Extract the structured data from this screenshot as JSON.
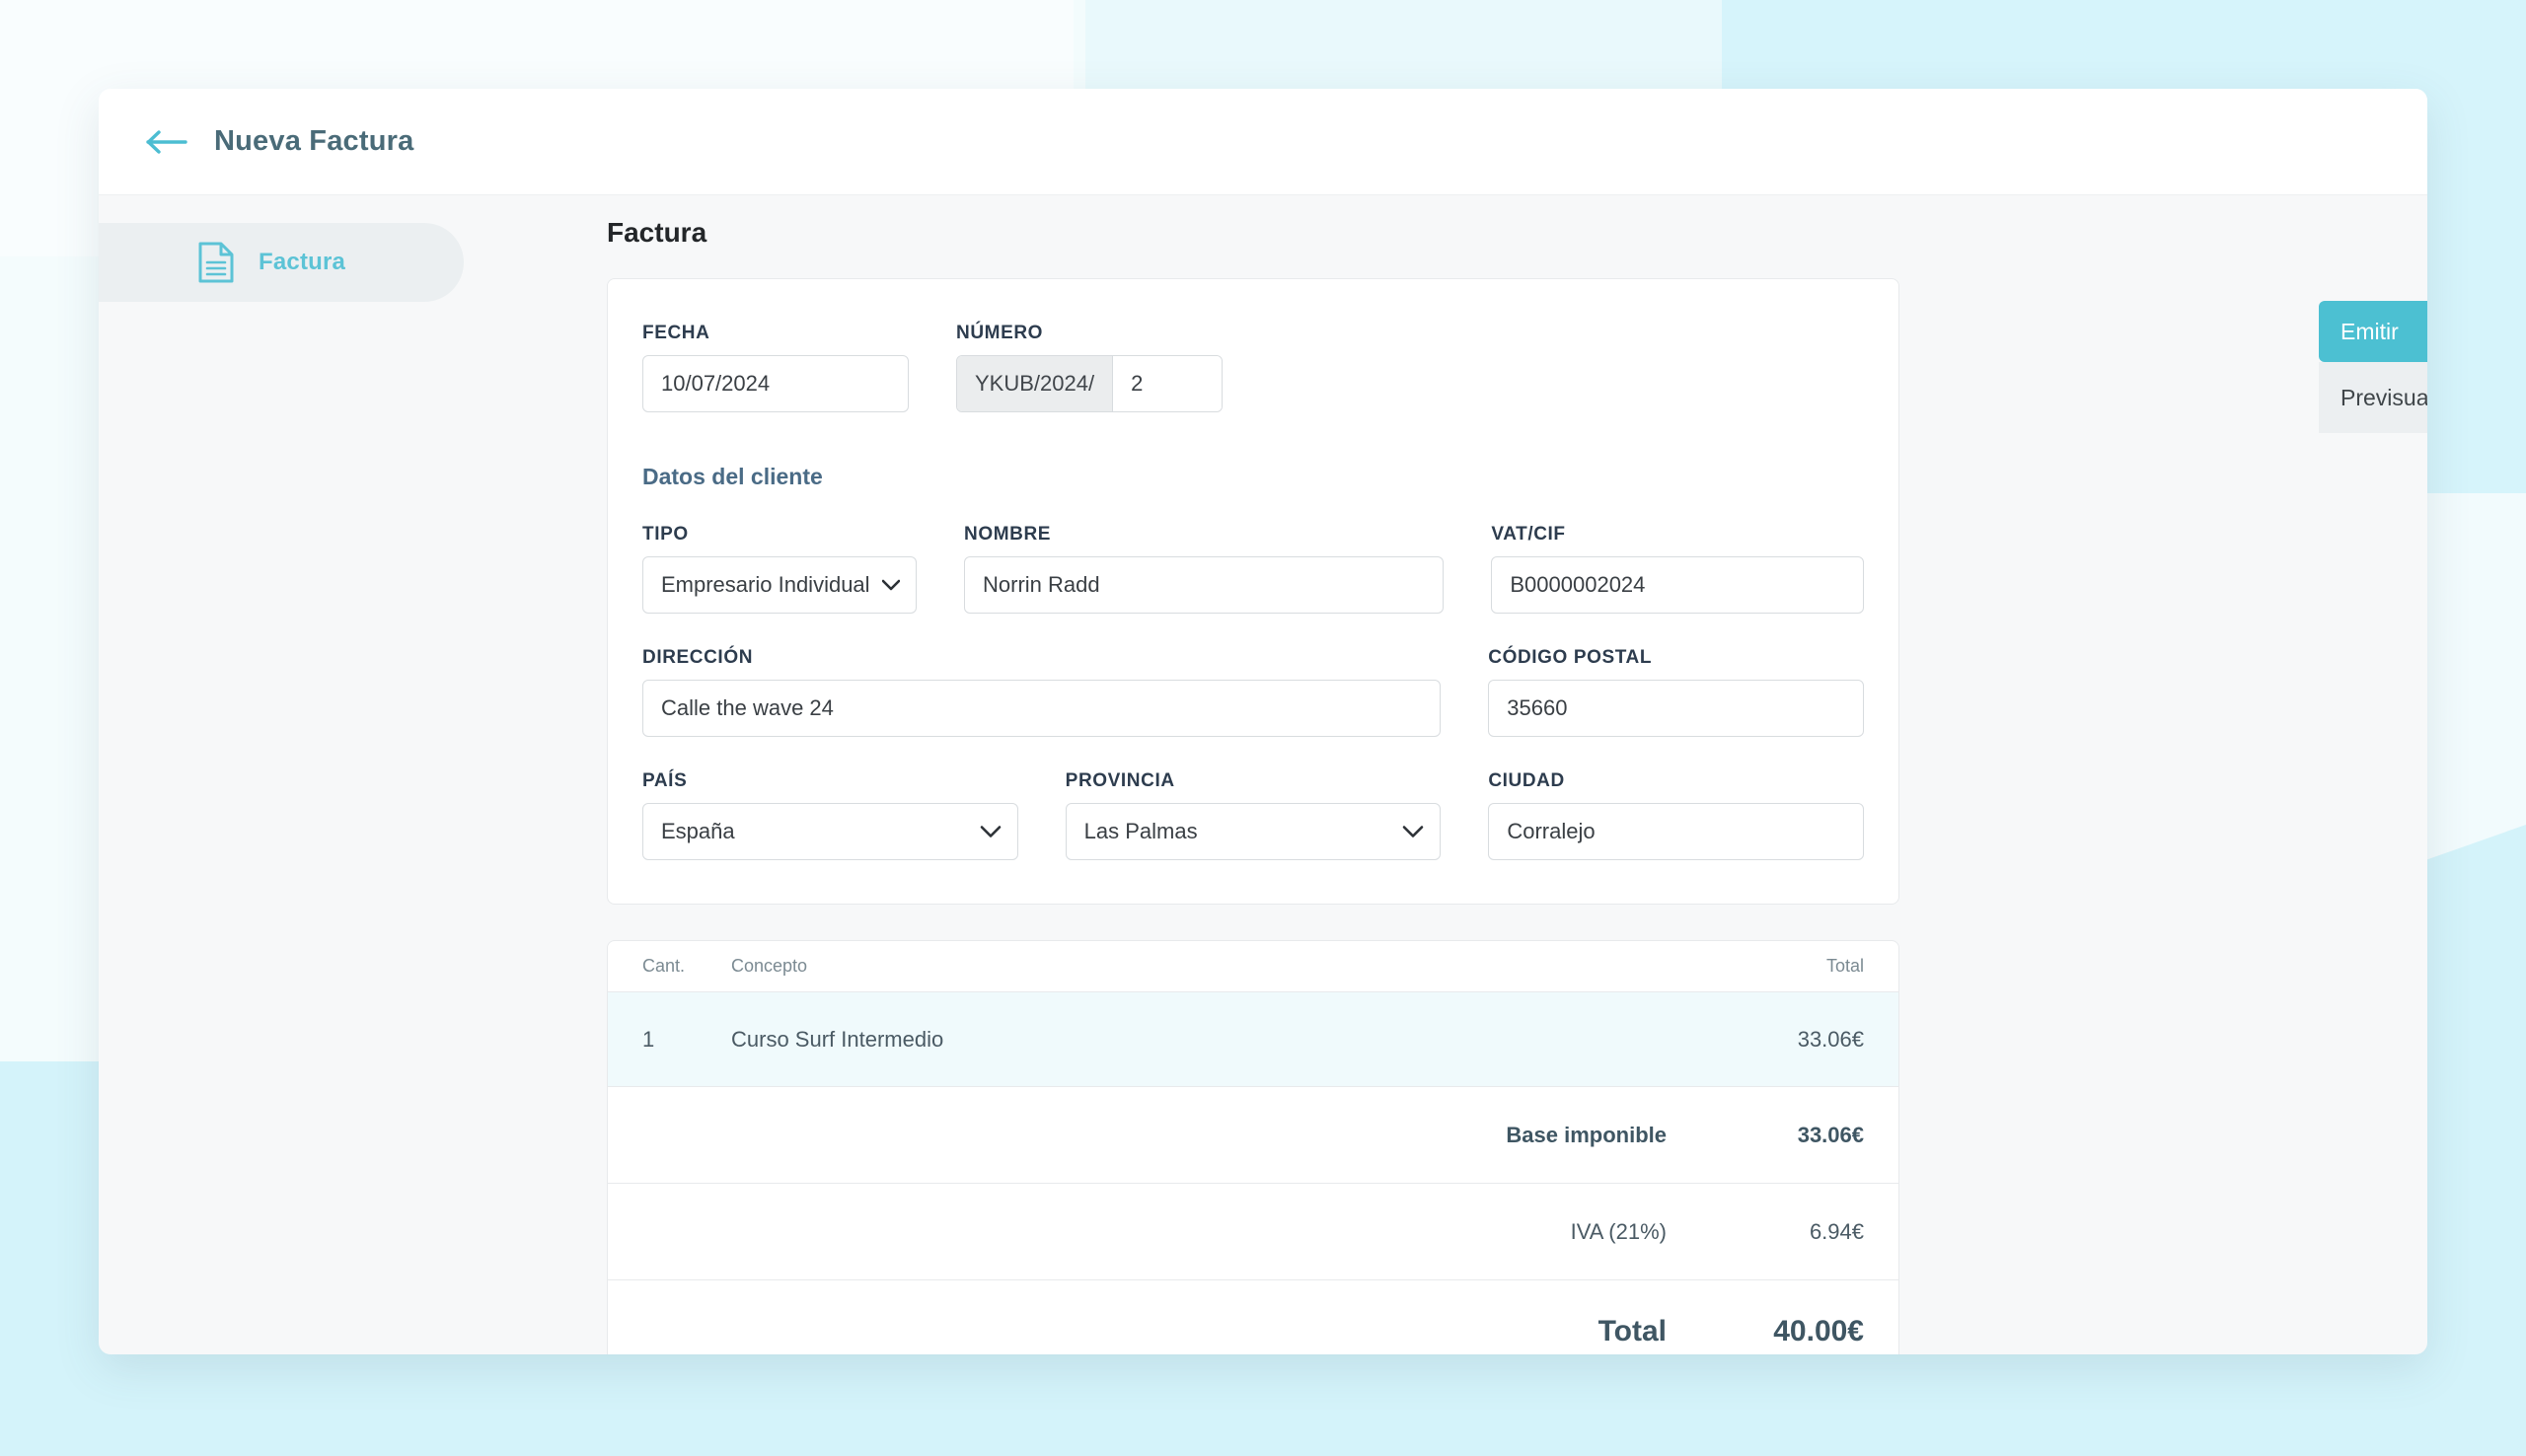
{
  "theme": {
    "accent": "#4cc0d2",
    "accent_text": "#5cc3d6",
    "title_color": "#4a6b78",
    "label_color": "#2d3c4e",
    "subheading_color": "#4a6b86",
    "page_bg": "#f7f8f9",
    "row_highlight": "#f0fafc"
  },
  "header": {
    "back_icon": "arrow-left-icon",
    "title": "Nueva Factura"
  },
  "sidebar": {
    "items": [
      {
        "label": "Factura",
        "icon": "document-text-icon",
        "active": true
      }
    ]
  },
  "main": {
    "section_title": "Factura",
    "invoice": {
      "fecha": {
        "label": "FECHA",
        "value": "10/07/2024"
      },
      "numero": {
        "label": "NÚMERO",
        "prefix": "YKUB/2024/",
        "value": "2"
      }
    },
    "client": {
      "subheading": "Datos del cliente",
      "tipo": {
        "label": "TIPO",
        "value": "Empresario Individual (Au",
        "full_value": "Empresario Individual (Autónomo)",
        "icon": "chevron-down-icon"
      },
      "nombre": {
        "label": "NOMBRE",
        "value": "Norrin Radd"
      },
      "vat": {
        "label": "VAT/CIF",
        "value": "B0000002024"
      },
      "direccion": {
        "label": "DIRECCIÓN",
        "value": "Calle the wave 24"
      },
      "codigo_postal": {
        "label": "CÓDIGO POSTAL",
        "value": "35660"
      },
      "pais": {
        "label": "PAÍS",
        "value": "España",
        "icon": "chevron-down-icon"
      },
      "provincia": {
        "label": "PROVINCIA",
        "value": "Las Palmas",
        "icon": "chevron-down-icon"
      },
      "ciudad": {
        "label": "CIUDAD",
        "value": "Corralejo"
      }
    },
    "items_table": {
      "headers": {
        "qty": "Cant.",
        "concept": "Concepto",
        "total": "Total"
      },
      "rows": [
        {
          "qty": "1",
          "concept": "Curso Surf Intermedio",
          "total": "33.06€"
        }
      ],
      "summary": [
        {
          "label": "Base imponible",
          "value": "33.06€",
          "style": "bold"
        },
        {
          "label": "IVA (21%)",
          "value": "6.94€",
          "style": "normal"
        },
        {
          "label": "Total",
          "value": "40.00€",
          "style": "grand"
        }
      ]
    }
  },
  "actions": {
    "emit": {
      "label": "Emitir",
      "icon": "save-floppy-icon"
    },
    "preview": {
      "label": "Previsualizar",
      "icon": "eye-icon"
    }
  }
}
